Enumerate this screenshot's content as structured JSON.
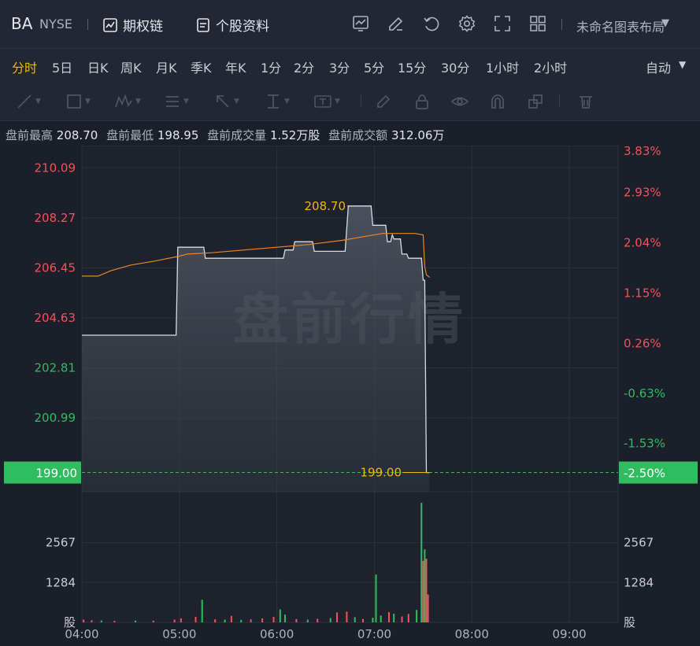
{
  "header": {
    "ticker": "BA",
    "exchange": "NYSE",
    "options_label": "期权链",
    "profile_label": "个股资料",
    "layout_name": "未命名图表布局"
  },
  "periods": [
    "分时",
    "5日",
    "日K",
    "周K",
    "月K",
    "季K",
    "年K",
    "1分",
    "2分",
    "3分",
    "5分",
    "15分",
    "30分",
    "1小时",
    "2小时"
  ],
  "active_period": 0,
  "scale_mode": "自动",
  "premarket": {
    "high_label": "盘前最高",
    "high": "208.70",
    "low_label": "盘前最低",
    "low": "198.95",
    "volume_label": "盘前成交量",
    "volume": "1.52万股",
    "turnover_label": "盘前成交额",
    "turnover": "312.06万"
  },
  "watermark": "盘前行情",
  "colors": {
    "up": "#f0535a",
    "down": "#2fbd5f",
    "price_line": "#d8dbe2",
    "avg_line": "#e8862a",
    "accent": "#f0b90b",
    "current_bg": "#2fbd5f"
  },
  "chart_data": {
    "type": "line",
    "x_ticks": [
      "04:00",
      "05:00",
      "06:00",
      "07:00",
      "08:00",
      "09:00"
    ],
    "x_range": [
      "04:00",
      "09:30"
    ],
    "price_ticks": [
      "210.09",
      "208.27",
      "206.45",
      "204.63",
      "202.81",
      "200.99"
    ],
    "pct_ticks": [
      "3.83%",
      "2.93%",
      "2.04%",
      "1.15%",
      "0.26%",
      "-0.63%",
      "-1.53%"
    ],
    "ylim": [
      198.3,
      210.9
    ],
    "current_price": "199.00",
    "current_pct": "-2.50%",
    "high_label": "208.70",
    "low_label": "199.00",
    "volume_ticks": [
      "2567",
      "1284"
    ],
    "volume_unit": "股",
    "volume_max": 3850,
    "price": [
      [
        "04:00",
        204.0
      ],
      [
        "04:58",
        204.0
      ],
      [
        "04:59",
        207.2
      ],
      [
        "05:15",
        207.2
      ],
      [
        "05:16",
        206.8
      ],
      [
        "06:04",
        206.8
      ],
      [
        "06:05",
        207.1
      ],
      [
        "06:10",
        207.1
      ],
      [
        "06:11",
        207.4
      ],
      [
        "06:22",
        207.4
      ],
      [
        "06:23",
        207.05
      ],
      [
        "06:42",
        207.05
      ],
      [
        "06:44",
        208.7
      ],
      [
        "06:58",
        208.7
      ],
      [
        "06:59",
        208.0
      ],
      [
        "07:07",
        208.0
      ],
      [
        "07:08",
        207.4
      ],
      [
        "07:10",
        207.4
      ],
      [
        "07:11",
        207.65
      ],
      [
        "07:12",
        207.5
      ],
      [
        "07:16",
        207.5
      ],
      [
        "07:17",
        206.95
      ],
      [
        "07:20",
        206.95
      ],
      [
        "07:21",
        206.8
      ],
      [
        "07:29",
        206.8
      ],
      [
        "07:30",
        206.0
      ],
      [
        "07:31",
        206.0
      ],
      [
        "07:32",
        199.0
      ],
      [
        "07:34",
        199.0
      ]
    ],
    "avg": [
      [
        "04:00",
        206.15
      ],
      [
        "04:10",
        206.15
      ],
      [
        "04:18",
        206.35
      ],
      [
        "04:30",
        206.55
      ],
      [
        "04:45",
        206.7
      ],
      [
        "04:58",
        206.85
      ],
      [
        "05:05",
        206.95
      ],
      [
        "05:20",
        207.0
      ],
      [
        "05:40",
        207.1
      ],
      [
        "06:00",
        207.2
      ],
      [
        "06:20",
        207.3
      ],
      [
        "06:40",
        207.45
      ],
      [
        "06:55",
        207.6
      ],
      [
        "07:05",
        207.7
      ],
      [
        "07:15",
        207.7
      ],
      [
        "07:25",
        207.7
      ],
      [
        "07:30",
        207.65
      ],
      [
        "07:31",
        206.5
      ],
      [
        "07:32",
        206.2
      ],
      [
        "07:34",
        206.1
      ]
    ],
    "volume": [
      [
        "04:01",
        90,
        "up"
      ],
      [
        "04:06",
        70,
        "up"
      ],
      [
        "04:12",
        60,
        "down"
      ],
      [
        "04:20",
        50,
        "up"
      ],
      [
        "04:33",
        60,
        "down"
      ],
      [
        "04:44",
        55,
        "up"
      ],
      [
        "04:57",
        90,
        "up"
      ],
      [
        "05:01",
        130,
        "up"
      ],
      [
        "05:10",
        180,
        "up"
      ],
      [
        "05:14",
        730,
        "down"
      ],
      [
        "05:22",
        100,
        "up"
      ],
      [
        "05:28",
        90,
        "down"
      ],
      [
        "05:32",
        210,
        "up"
      ],
      [
        "05:38",
        80,
        "down"
      ],
      [
        "05:44",
        100,
        "up"
      ],
      [
        "05:51",
        130,
        "up"
      ],
      [
        "05:58",
        180,
        "up"
      ],
      [
        "06:02",
        420,
        "down"
      ],
      [
        "06:05",
        250,
        "down"
      ],
      [
        "06:12",
        110,
        "up"
      ],
      [
        "06:19",
        90,
        "down"
      ],
      [
        "06:25",
        120,
        "up"
      ],
      [
        "06:33",
        140,
        "down"
      ],
      [
        "06:37",
        320,
        "up"
      ],
      [
        "06:43",
        350,
        "up"
      ],
      [
        "06:48",
        170,
        "down"
      ],
      [
        "06:53",
        110,
        "up"
      ],
      [
        "06:59",
        150,
        "down"
      ],
      [
        "07:01",
        1540,
        "down"
      ],
      [
        "07:04",
        220,
        "down"
      ],
      [
        "07:09",
        330,
        "up"
      ],
      [
        "07:12",
        280,
        "down"
      ],
      [
        "07:17",
        190,
        "up"
      ],
      [
        "07:21",
        270,
        "up"
      ],
      [
        "07:26",
        400,
        "down"
      ],
      [
        "07:29",
        3850,
        "down"
      ],
      [
        "07:30",
        1980,
        "up"
      ],
      [
        "07:31",
        2350,
        "down"
      ],
      [
        "07:32",
        2050,
        "up"
      ],
      [
        "07:33",
        900,
        "up"
      ]
    ]
  }
}
